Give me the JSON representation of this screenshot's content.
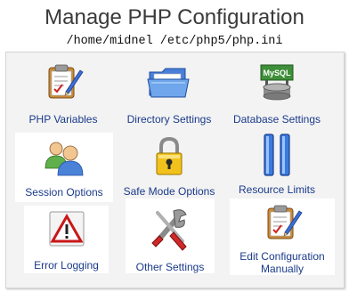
{
  "header": {
    "title": "Manage PHP Configuration",
    "path": "/home/midnel /etc/php5/php.ini"
  },
  "tiles": [
    {
      "label": "PHP Variables",
      "icon": "clipboard-pencil-icon"
    },
    {
      "label": "Directory Settings",
      "icon": "folder-icon"
    },
    {
      "label": "Database Settings",
      "icon": "mysql-sign-icon",
      "icon_text": "MySQL"
    },
    {
      "label": "Session Options",
      "icon": "users-icon"
    },
    {
      "label": "Safe Mode Options",
      "icon": "padlock-icon"
    },
    {
      "label": "Resource Limits",
      "icon": "pause-bars-icon"
    },
    {
      "label": "Error Logging",
      "icon": "warning-sign-icon"
    },
    {
      "label": "Other Settings",
      "icon": "tools-icon"
    },
    {
      "label": "Edit Configuration Manually",
      "icon": "clipboard-pencil-icon"
    }
  ],
  "colors": {
    "label": "#1a3a8a",
    "title": "#3a3a3a",
    "panel_bg": "#f3f3f3",
    "mysql_green": "#3f8f3a"
  }
}
